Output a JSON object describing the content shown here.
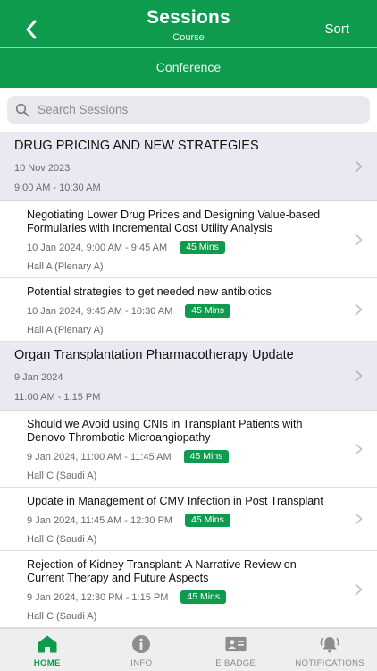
{
  "header": {
    "title": "Sessions",
    "subtitle": "Course",
    "sort_label": "Sort",
    "tab_label": "Conference",
    "accent_color": "#0e9b4d"
  },
  "search": {
    "placeholder": "Search Sessions"
  },
  "groups": [
    {
      "title": "DRUG PRICING AND NEW STRATEGIES",
      "date": "10 Nov 2023",
      "time": "9:00 AM - 10:30 AM",
      "sessions": [
        {
          "title": "Negotiating Lower Drug Prices and Designing Value-based Formularies with Incremental Cost Utility Analysis",
          "datetime": "10 Jan 2024, 9:00 AM - 9:45 AM",
          "duration": "45 Mins",
          "hall": "Hall A (Plenary A)"
        },
        {
          "title": "Potential strategies to get needed new antibiotics",
          "datetime": "10 Jan 2024, 9:45 AM - 10:30 AM",
          "duration": "45 Mins",
          "hall": "Hall A (Plenary A)"
        }
      ]
    },
    {
      "title": "Organ Transplantation Pharmacotherapy Update",
      "date": "9 Jan 2024",
      "time": "11:00 AM - 1:15 PM",
      "sessions": [
        {
          "title": "Should we Avoid using CNIs in Transplant Patients with Denovo Thrombotic Microangiopathy",
          "datetime": "9 Jan 2024, 11:00 AM - 11:45 AM",
          "duration": "45 Mins",
          "hall": "Hall C (Saudi A)"
        },
        {
          "title": "Update in Management of CMV Infection in Post Transplant",
          "datetime": "9 Jan 2024, 11:45 AM - 12:30 PM",
          "duration": "45 Mins",
          "hall": "Hall C (Saudi A)"
        },
        {
          "title": "Rejection of Kidney Transplant: A Narrative Review on Current Therapy and Future Aspects",
          "datetime": "9 Jan 2024, 12:30 PM - 1:15 PM",
          "duration": "45 Mins",
          "hall": "Hall C (Saudi A)"
        }
      ]
    }
  ],
  "bottom_nav": [
    {
      "label": "HOME",
      "icon": "home-icon",
      "active": true
    },
    {
      "label": "INFO",
      "icon": "info-icon",
      "active": false
    },
    {
      "label": "E BADGE",
      "icon": "badge-icon",
      "active": false
    },
    {
      "label": "NOTIFICATIONS",
      "icon": "bell-icon",
      "active": false
    }
  ]
}
